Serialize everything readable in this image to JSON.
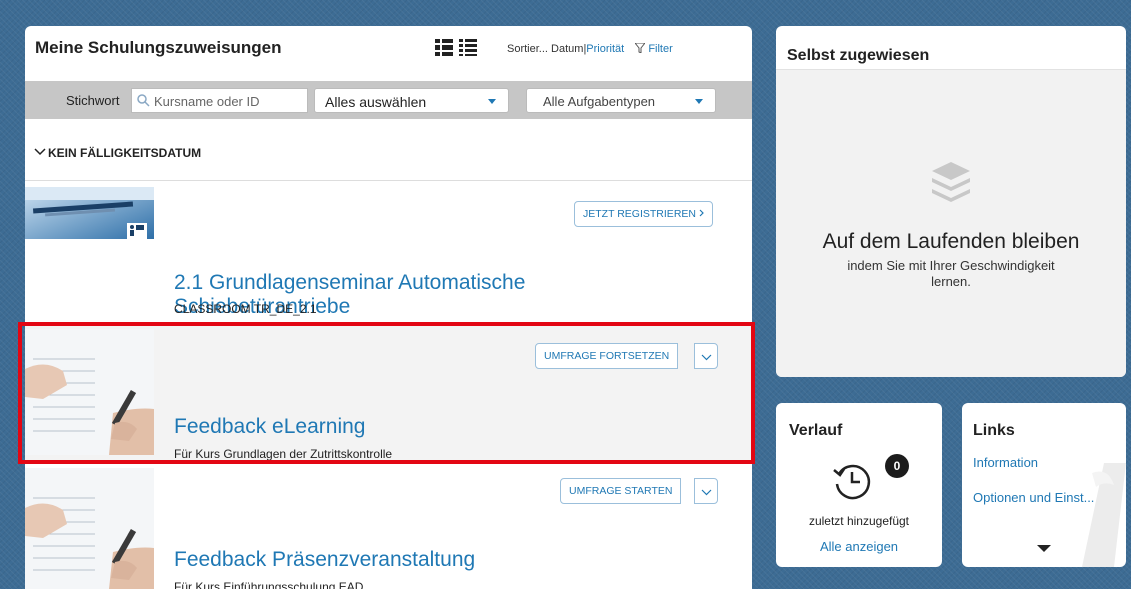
{
  "main": {
    "title": "Meine Schulungszuweisungen",
    "sort_label": "Sortier...",
    "sort_date": "Datum",
    "sort_priority": "Priorität",
    "filter_label": "Filter",
    "keyword_label": "Stichwort",
    "search_placeholder": "Kursname oder ID",
    "select_all": "Alles auswählen",
    "task_types": "Alle Aufgabentypen",
    "section_label": "KEIN FÄLLIGKEITSDATUM",
    "courses": [
      {
        "title_line1": "2.1 Grundlagenseminar Automatische",
        "title_line2": "Schiebetürantriebe",
        "subtitle": "CLASSROOM TR_DE_2.1",
        "action": "JETZT REGISTRIEREN"
      },
      {
        "title_line1": "Feedback eLearning",
        "subtitle": "Für Kurs Grundlagen der Zutrittskontrolle",
        "action": "UMFRAGE FORTSETZEN"
      },
      {
        "title_line1": "Feedback Präsenzveranstaltung",
        "subtitle": "Für Kurs Einführungsschulung EAD",
        "action": "UMFRAGE STARTEN"
      }
    ]
  },
  "self_assigned": {
    "title": "Selbst zugewiesen",
    "headline": "Auf dem Laufenden bleiben",
    "subtext": "indem Sie mit Ihrer Geschwindigkeit lernen."
  },
  "history": {
    "title": "Verlauf",
    "count": "0",
    "subtitle": "zuletzt hinzugefügt",
    "link": "Alle anzeigen"
  },
  "links": {
    "title": "Links",
    "items": [
      "Information",
      "Optionen und Einst..."
    ]
  },
  "colors": {
    "link_blue": "#1f78b4",
    "highlight_red": "#e30613",
    "background_blue": "#3d6c94"
  }
}
